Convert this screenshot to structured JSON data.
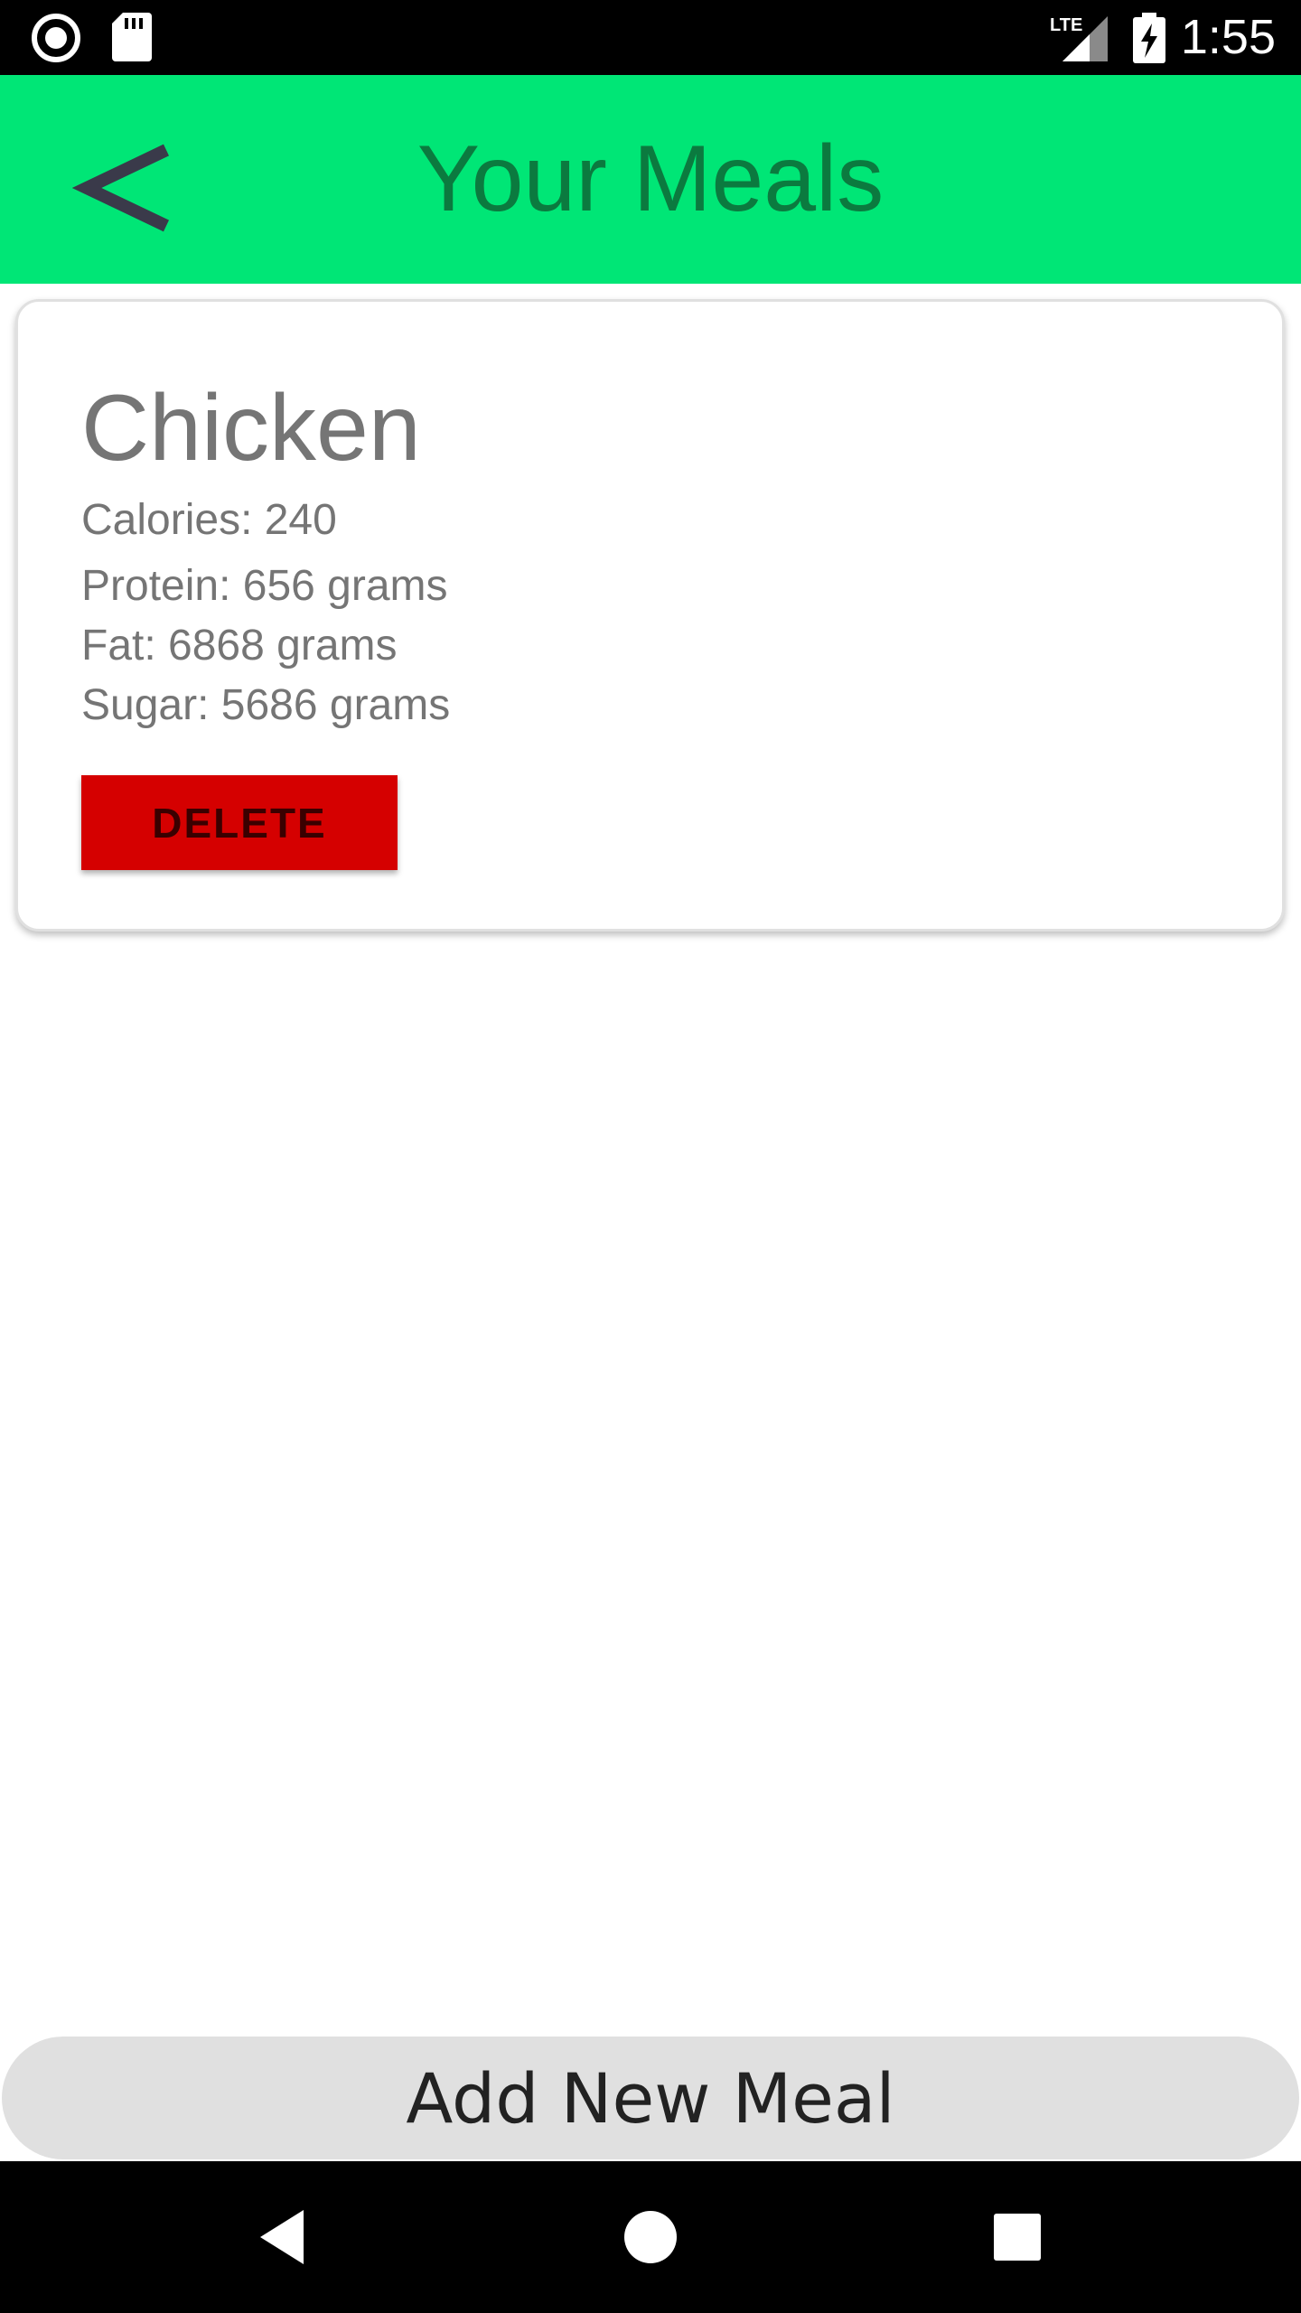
{
  "status_bar": {
    "time": "1:55",
    "icons": [
      "record-icon",
      "sd-card-icon",
      "lte-signal-icon",
      "battery-charging-icon"
    ]
  },
  "app_bar": {
    "title": "Your Meals",
    "back_icon": "chevron-left-icon",
    "background": "#00e676",
    "title_color": "#0b7a3f"
  },
  "meals": [
    {
      "name": "Chicken",
      "calories": "Calories: 240",
      "protein": "Protein: 656 grams",
      "fat": "Fat: 6868 grams",
      "sugar": "Sugar: 5686 grams",
      "delete_label": "DELETE",
      "delete_color": "#d50000"
    }
  ],
  "add_meal": {
    "label": "Add New Meal"
  },
  "nav_bar": {
    "icons": [
      "back-triangle-icon",
      "home-circle-icon",
      "recents-square-icon"
    ]
  }
}
